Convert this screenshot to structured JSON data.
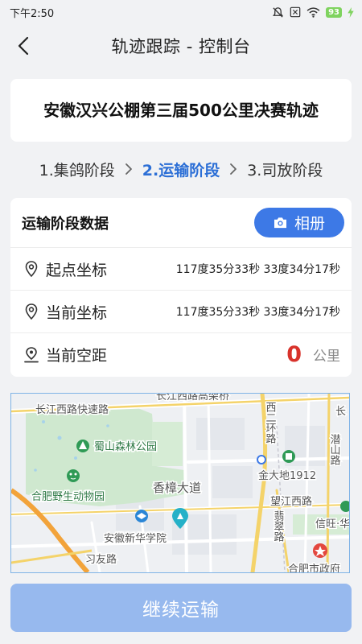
{
  "status_bar": {
    "time": "下午2:50",
    "battery": "93"
  },
  "nav": {
    "title": "轨迹跟踪 - 控制台"
  },
  "race_title": "安徽汉兴公棚第三届500公里决赛轨迹",
  "steps": [
    {
      "label": "1.集鸽阶段",
      "active": false
    },
    {
      "label": "2.运输阶段",
      "active": true
    },
    {
      "label": "3.司放阶段",
      "active": false
    }
  ],
  "card": {
    "title": "运输阶段数据",
    "album_label": "相册",
    "start_label": "起点坐标",
    "start_value": "117度35分33秒 33度34分17秒",
    "current_label": "当前坐标",
    "current_value": "117度35分33秒 33度34分17秒",
    "distance_label": "当前空距",
    "distance_value": "0",
    "distance_unit": "公里"
  },
  "map": {
    "labels": {
      "changjiang_west_expressway": "长江西路快速路",
      "changjiang_west_elevated": "长江西路高架桥",
      "west_second_ring": "西二环路",
      "shushan_park": "蜀山森林公园",
      "hefei_zoo": "合肥野生动物园",
      "xiangzhang_avenue": "香樟大道",
      "anhui_xinhua": "安徽新华学院",
      "xiyou_road": "习友路",
      "jinda_1912": "金大地1912",
      "wangjiang_west": "望江西路",
      "feicui_road": "翡翠路",
      "qianshan_road": "潜山路",
      "xinwang": "信旺·华",
      "hefei_gov": "合肥市政府",
      "chang": "长"
    }
  },
  "continue_label": "继续运输"
}
